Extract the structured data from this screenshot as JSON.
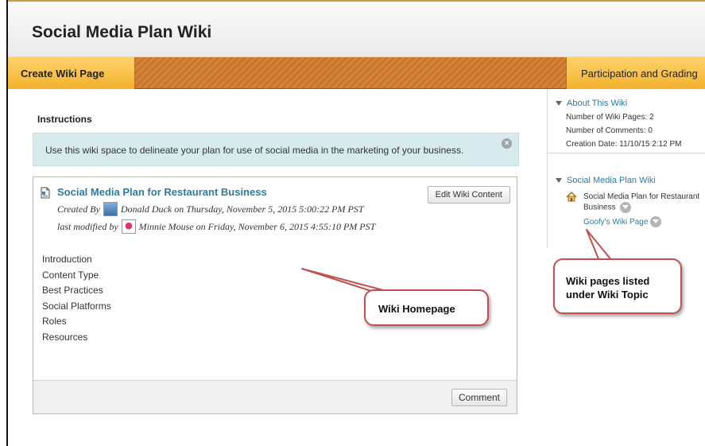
{
  "header": {
    "title": "Social Media Plan Wiki"
  },
  "action_bar": {
    "create_label": "Create Wiki Page",
    "grading_label": "Participation and Grading"
  },
  "instructions": {
    "title": "Instructions",
    "text": "Use this wiki space to delineate your plan for use of social media in the marketing of your business."
  },
  "wiki_page": {
    "title": "Social Media Plan for Restaurant Business",
    "edit_label": "Edit Wiki Content",
    "created_prefix": "Created By",
    "created_user": "Donald Duck on Thursday, November 5, 2015 5:00:22 PM PST",
    "modified_prefix": "last modified by",
    "modified_user": "Minnie Mouse on Friday, November 6, 2015 4:55:10 PM PST",
    "toc": [
      "Introduction",
      "Content Type",
      "Best Practices",
      "Social Platforms",
      "Roles",
      "Resources"
    ],
    "comment_label": "Comment"
  },
  "sidebar": {
    "about": {
      "heading": "About This Wiki",
      "pages": "Number of Wiki Pages: 2",
      "comments": "Number of Comments: 0",
      "created": "Creation Date: 11/10/15 2:12 PM"
    },
    "topic": {
      "heading": "Social Media Plan Wiki",
      "home_page": "Social Media Plan for Restaurant Business",
      "sub_page": "Goofy's Wiki Page"
    }
  },
  "callouts": {
    "homepage": "Wiki Homepage",
    "pages_line1": "Wiki pages listed",
    "pages_line2": "under Wiki Topic"
  },
  "colors": {
    "accent_link": "#2a7d9e",
    "action_bar": "#c8742a",
    "button_gold": "#f3b12d",
    "callout_border": "#c0504d",
    "instructions_bg": "#d7ebef"
  }
}
